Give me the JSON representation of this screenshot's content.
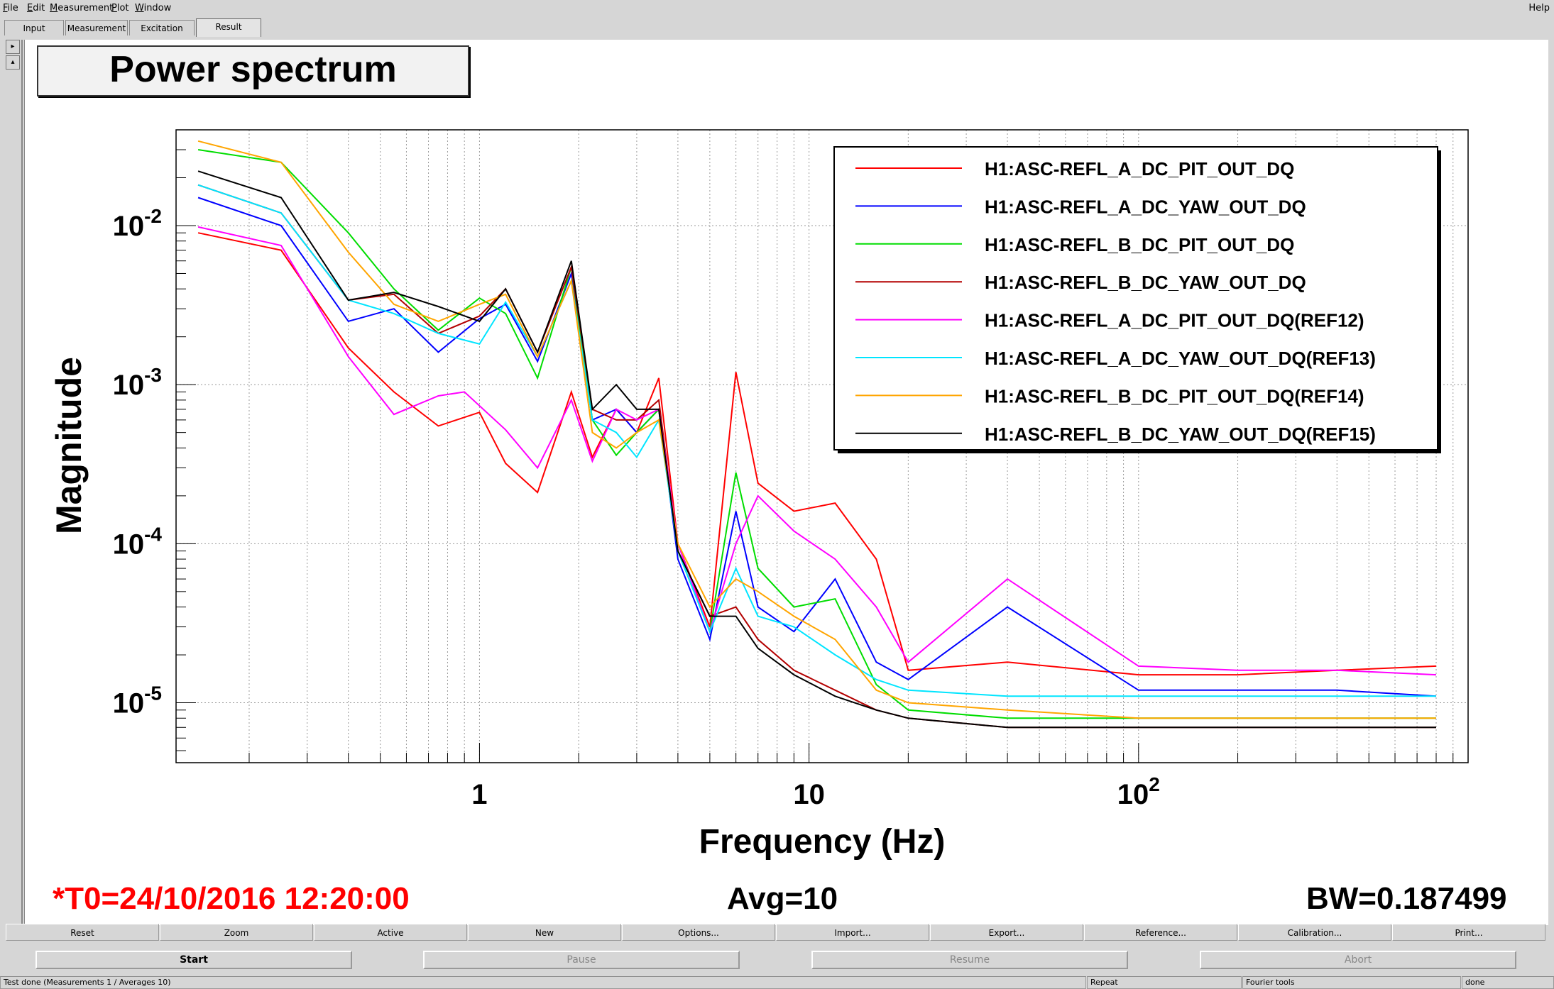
{
  "menubar": {
    "items": [
      {
        "label": "File",
        "ul": "F",
        "rest": "ile"
      },
      {
        "label": "Edit",
        "ul": "E",
        "rest": "dit"
      },
      {
        "label": "Measurement",
        "ul": "M",
        "rest": "easurement"
      },
      {
        "label": "Plot",
        "ul": "P",
        "rest": "lot"
      },
      {
        "label": "Window",
        "ul": "W",
        "rest": "indow"
      }
    ],
    "help": "Help"
  },
  "tabs": [
    "Input",
    "Measurement",
    "Excitation",
    "Result"
  ],
  "active_tab": "Result",
  "plot": {
    "title": "Power spectrum",
    "status_t0": "*T0=24/10/2016 12:20:00",
    "status_avg": "Avg=10",
    "status_bw": "BW=0.187499"
  },
  "chart_data": {
    "type": "line",
    "xlabel": "Frequency (Hz)",
    "ylabel": "Magnitude",
    "xscale": "log",
    "yscale": "log",
    "xlim": [
      0.12,
      1000
    ],
    "ylim": [
      4.2e-06,
      0.04
    ],
    "x_tick_labels": [
      {
        "base": "1",
        "exp": ""
      },
      {
        "base": "10",
        "exp": ""
      },
      {
        "base": "10",
        "exp": "2"
      }
    ],
    "y_tick_labels": [
      {
        "base": "10",
        "exp": "-2"
      },
      {
        "base": "10",
        "exp": "-3"
      },
      {
        "base": "10",
        "exp": "-4"
      },
      {
        "base": "10",
        "exp": "-5"
      }
    ],
    "grid": true,
    "legend_position": "top-right",
    "series": [
      {
        "name": "H1:ASC-REFL_A_DC_PIT_OUT_DQ",
        "color": "#ff0000",
        "x": [
          0.14,
          0.25,
          0.4,
          0.55,
          0.75,
          1.0,
          1.2,
          1.5,
          1.9,
          2.2,
          2.6,
          3.0,
          3.5,
          4.0,
          5.0,
          6.0,
          7.0,
          9.0,
          12.0,
          16.0,
          20.0,
          40.0,
          100.0,
          200.0,
          400.0,
          800.0
        ],
        "y": [
          0.009,
          0.007,
          0.0017,
          0.0009,
          0.00055,
          0.00067,
          0.00032,
          0.00021,
          0.0009,
          0.00035,
          0.0007,
          0.0005,
          0.0011,
          0.0001,
          3e-05,
          0.0012,
          0.00024,
          0.00016,
          0.00018,
          8e-05,
          1.6e-05,
          1.8e-05,
          1.5e-05,
          1.5e-05,
          1.6e-05,
          1.7e-05
        ]
      },
      {
        "name": "H1:ASC-REFL_A_DC_YAW_OUT_DQ",
        "color": "#0000ff",
        "x": [
          0.14,
          0.25,
          0.4,
          0.55,
          0.75,
          1.0,
          1.2,
          1.5,
          1.9,
          2.2,
          2.6,
          3.0,
          3.5,
          4.0,
          5.0,
          6.0,
          7.0,
          9.0,
          12.0,
          16.0,
          20.0,
          40.0,
          100.0,
          200.0,
          400.0,
          800.0
        ],
        "y": [
          0.015,
          0.01,
          0.0025,
          0.003,
          0.0016,
          0.0026,
          0.0032,
          0.0014,
          0.005,
          0.0006,
          0.0007,
          0.0005,
          0.0007,
          8e-05,
          2.5e-05,
          0.00016,
          4e-05,
          2.8e-05,
          6e-05,
          1.8e-05,
          1.4e-05,
          4e-05,
          1.2e-05,
          1.2e-05,
          1.2e-05,
          1.1e-05
        ]
      },
      {
        "name": "H1:ASC-REFL_B_DC_PIT_OUT_DQ",
        "color": "#00dd00",
        "x": [
          0.14,
          0.25,
          0.4,
          0.55,
          0.75,
          1.0,
          1.2,
          1.5,
          1.9,
          2.2,
          2.6,
          3.0,
          3.5,
          4.0,
          5.0,
          6.0,
          7.0,
          9.0,
          12.0,
          16.0,
          20.0,
          40.0,
          100.0,
          200.0,
          400.0,
          800.0
        ],
        "y": [
          0.03,
          0.025,
          0.009,
          0.004,
          0.0022,
          0.0035,
          0.0028,
          0.0011,
          0.0055,
          0.0006,
          0.00036,
          0.0005,
          0.0007,
          9e-05,
          2.8e-05,
          0.00028,
          7e-05,
          4e-05,
          4.5e-05,
          1.3e-05,
          9e-06,
          8e-06,
          8e-06,
          8e-06,
          8e-06,
          8e-06
        ]
      },
      {
        "name": "H1:ASC-REFL_B_DC_YAW_OUT_DQ",
        "color": "#b30000",
        "x": [
          0.14,
          0.25,
          0.4,
          0.55,
          0.75,
          1.0,
          1.2,
          1.5,
          1.9,
          2.2,
          2.6,
          3.0,
          3.5,
          4.0,
          5.0,
          6.0,
          7.0,
          9.0,
          12.0,
          16.0,
          20.0,
          40.0,
          100.0,
          200.0,
          400.0,
          800.0
        ],
        "y": [
          0.018,
          0.012,
          0.0034,
          0.0037,
          0.0021,
          0.0027,
          0.004,
          0.0016,
          0.0055,
          0.0007,
          0.0006,
          0.0006,
          0.0008,
          9e-05,
          3.5e-05,
          4e-05,
          2.5e-05,
          1.6e-05,
          1.2e-05,
          9e-06,
          8e-06,
          7e-06,
          7e-06,
          7e-06,
          7e-06,
          7e-06
        ]
      },
      {
        "name": "H1:ASC-REFL_A_DC_PIT_OUT_DQ(REF12)",
        "color": "#ff00ff",
        "x": [
          0.14,
          0.25,
          0.4,
          0.55,
          0.75,
          0.9,
          1.2,
          1.5,
          1.9,
          2.2,
          2.6,
          3.0,
          3.5,
          4.0,
          5.0,
          6.0,
          7.0,
          9.0,
          12.0,
          16.0,
          20.0,
          40.0,
          100.0,
          200.0,
          400.0,
          800.0
        ],
        "y": [
          0.0098,
          0.0075,
          0.0015,
          0.00065,
          0.00085,
          0.0009,
          0.00052,
          0.0003,
          0.0008,
          0.00033,
          0.0007,
          0.0006,
          0.0007,
          0.0001,
          2.8e-05,
          0.0001,
          0.0002,
          0.00012,
          8e-05,
          4e-05,
          1.8e-05,
          6e-05,
          1.7e-05,
          1.6e-05,
          1.6e-05,
          1.5e-05
        ]
      },
      {
        "name": "H1:ASC-REFL_A_DC_YAW_OUT_DQ(REF13)",
        "color": "#00e5ff",
        "x": [
          0.14,
          0.25,
          0.4,
          0.55,
          0.75,
          1.0,
          1.2,
          1.5,
          1.9,
          2.2,
          2.6,
          3.0,
          3.5,
          4.0,
          5.0,
          6.0,
          7.0,
          9.0,
          12.0,
          16.0,
          20.0,
          40.0,
          100.0,
          200.0,
          400.0,
          800.0
        ],
        "y": [
          0.018,
          0.012,
          0.0034,
          0.0028,
          0.0021,
          0.0018,
          0.0033,
          0.0015,
          0.0045,
          0.0006,
          0.0005,
          0.00035,
          0.0006,
          9e-05,
          2.8e-05,
          7e-05,
          3.5e-05,
          3e-05,
          2e-05,
          1.4e-05,
          1.2e-05,
          1.1e-05,
          1.1e-05,
          1.1e-05,
          1.1e-05,
          1.1e-05
        ]
      },
      {
        "name": "H1:ASC-REFL_B_DC_PIT_OUT_DQ(REF14)",
        "color": "#ffa500",
        "x": [
          0.14,
          0.25,
          0.4,
          0.55,
          0.75,
          1.0,
          1.2,
          1.5,
          1.9,
          2.2,
          2.6,
          3.0,
          3.5,
          4.0,
          5.0,
          6.0,
          7.0,
          9.0,
          12.0,
          16.0,
          20.0,
          40.0,
          100.0,
          200.0,
          400.0,
          800.0
        ],
        "y": [
          0.034,
          0.025,
          0.0068,
          0.0032,
          0.0025,
          0.0032,
          0.0037,
          0.0015,
          0.0045,
          0.0005,
          0.0004,
          0.0005,
          0.0006,
          0.0001,
          4e-05,
          6e-05,
          5e-05,
          3.5e-05,
          2.5e-05,
          1.2e-05,
          1e-05,
          9e-06,
          8e-06,
          8e-06,
          8e-06,
          8e-06
        ]
      },
      {
        "name": "H1:ASC-REFL_B_DC_YAW_OUT_DQ(REF15)",
        "color": "#000000",
        "x": [
          0.14,
          0.25,
          0.4,
          0.55,
          0.75,
          1.0,
          1.2,
          1.5,
          1.9,
          2.2,
          2.6,
          3.0,
          3.5,
          4.0,
          5.0,
          6.0,
          7.0,
          9.0,
          12.0,
          16.0,
          20.0,
          40.0,
          100.0,
          200.0,
          400.0,
          800.0
        ],
        "y": [
          0.022,
          0.015,
          0.0034,
          0.0038,
          0.0031,
          0.0025,
          0.004,
          0.0016,
          0.006,
          0.0007,
          0.001,
          0.0007,
          0.0007,
          9e-05,
          3.5e-05,
          3.5e-05,
          2.2e-05,
          1.5e-05,
          1.1e-05,
          9e-06,
          8e-06,
          7e-06,
          7e-06,
          7e-06,
          7e-06,
          7e-06
        ]
      }
    ]
  },
  "buttons_row1": [
    "Reset",
    "Zoom",
    "Active",
    "New",
    "Options...",
    "Import...",
    "Export...",
    "Reference...",
    "Calibration...",
    "Print..."
  ],
  "buttons_row2": [
    {
      "label": "Start",
      "enabled": true
    },
    {
      "label": "Pause",
      "enabled": false
    },
    {
      "label": "Resume",
      "enabled": false
    },
    {
      "label": "Abort",
      "enabled": false
    }
  ],
  "statusbar": {
    "message": "Test done (Measurements 1 / Averages 10)",
    "mode": "Repeat",
    "tools": "Fourier tools",
    "state": "done"
  }
}
